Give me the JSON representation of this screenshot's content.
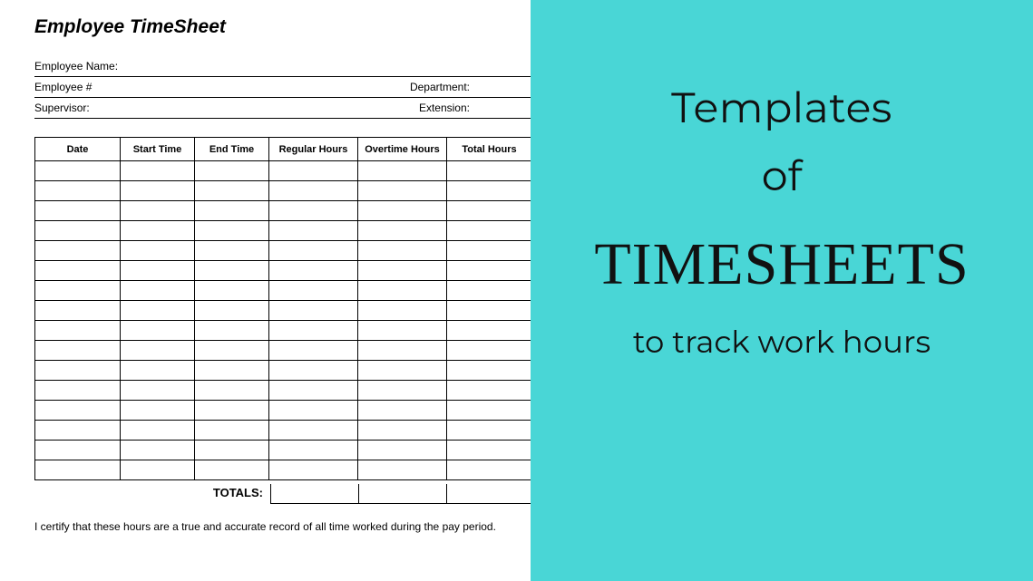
{
  "form": {
    "title": "Employee TimeSheet",
    "fields": {
      "employee_name_label": "Employee Name:",
      "employee_num_label": "Employee #",
      "department_label": "Department:",
      "supervisor_label": "Supervisor:",
      "extension_label": "Extension:"
    },
    "columns": {
      "date": "Date",
      "start_time": "Start Time",
      "end_time": "End Time",
      "regular_hours": "Regular Hours",
      "overtime_hours": "Overtime Hours",
      "total_hours": "Total Hours"
    },
    "blank_rows": 16,
    "totals_label": "TOTALS:",
    "certify_text": "I certify that these hours are a true and accurate record of all time worked during the pay period."
  },
  "promo": {
    "line1": "Templates",
    "line2": "of",
    "line3": "TIMESHEETS",
    "line4": "to track work hours"
  },
  "colors": {
    "accent": "#49d6d6"
  }
}
